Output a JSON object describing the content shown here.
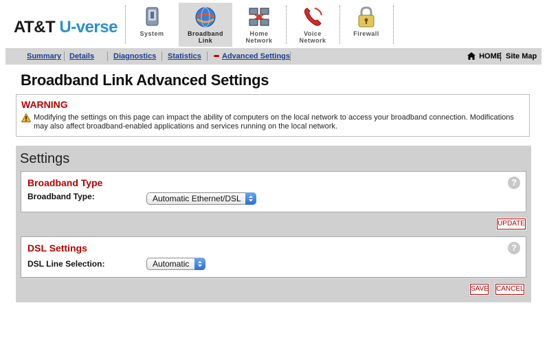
{
  "header": {
    "logo_part1": "AT&T",
    "logo_part2": "U-verse",
    "nav": [
      {
        "line1": "System",
        "line2": "",
        "icon": "system-icon"
      },
      {
        "line1": "Broadband",
        "line2": "Link",
        "icon": "broadband-globe-icon",
        "active": true
      },
      {
        "line1": "Home",
        "line2": "Network",
        "icon": "home-network-icon"
      },
      {
        "line1": "Voice",
        "line2": "Network",
        "icon": "voice-phone-icon"
      },
      {
        "line1": "Firewall",
        "line2": "",
        "icon": "padlock-icon"
      }
    ]
  },
  "subnav": {
    "items": [
      "Summary",
      "Details",
      "Diagnostics",
      "Statistics",
      "Advanced Settings"
    ],
    "active": "Advanced Settings",
    "home": "HOME",
    "sitemap": "Site Map"
  },
  "page_title": "Broadband Link Advanced Settings",
  "warning": {
    "title": "WARNING",
    "text": "Modifying the settings on this page can impact the ability of computers on the local network to access your broadband connection. Modifications may also affect broadband-enabled applications and services running on the local network."
  },
  "settings": {
    "title": "Settings",
    "broadband": {
      "title": "Broadband Type",
      "label": "Broadband Type:",
      "value": "Automatic Ethernet/DSL",
      "update_button": "UPDATE"
    },
    "dsl": {
      "title": "DSL Settings",
      "label": "DSL Line Selection:",
      "value": "Automatic"
    },
    "save_button": "SAVE",
    "cancel_button": "CANCEL"
  },
  "colors": {
    "accent_red": "#b50000",
    "link_blue": "#1a3d8f",
    "panel_gray": "#d0d0d0",
    "brand_blue": "#2a8fd0"
  }
}
